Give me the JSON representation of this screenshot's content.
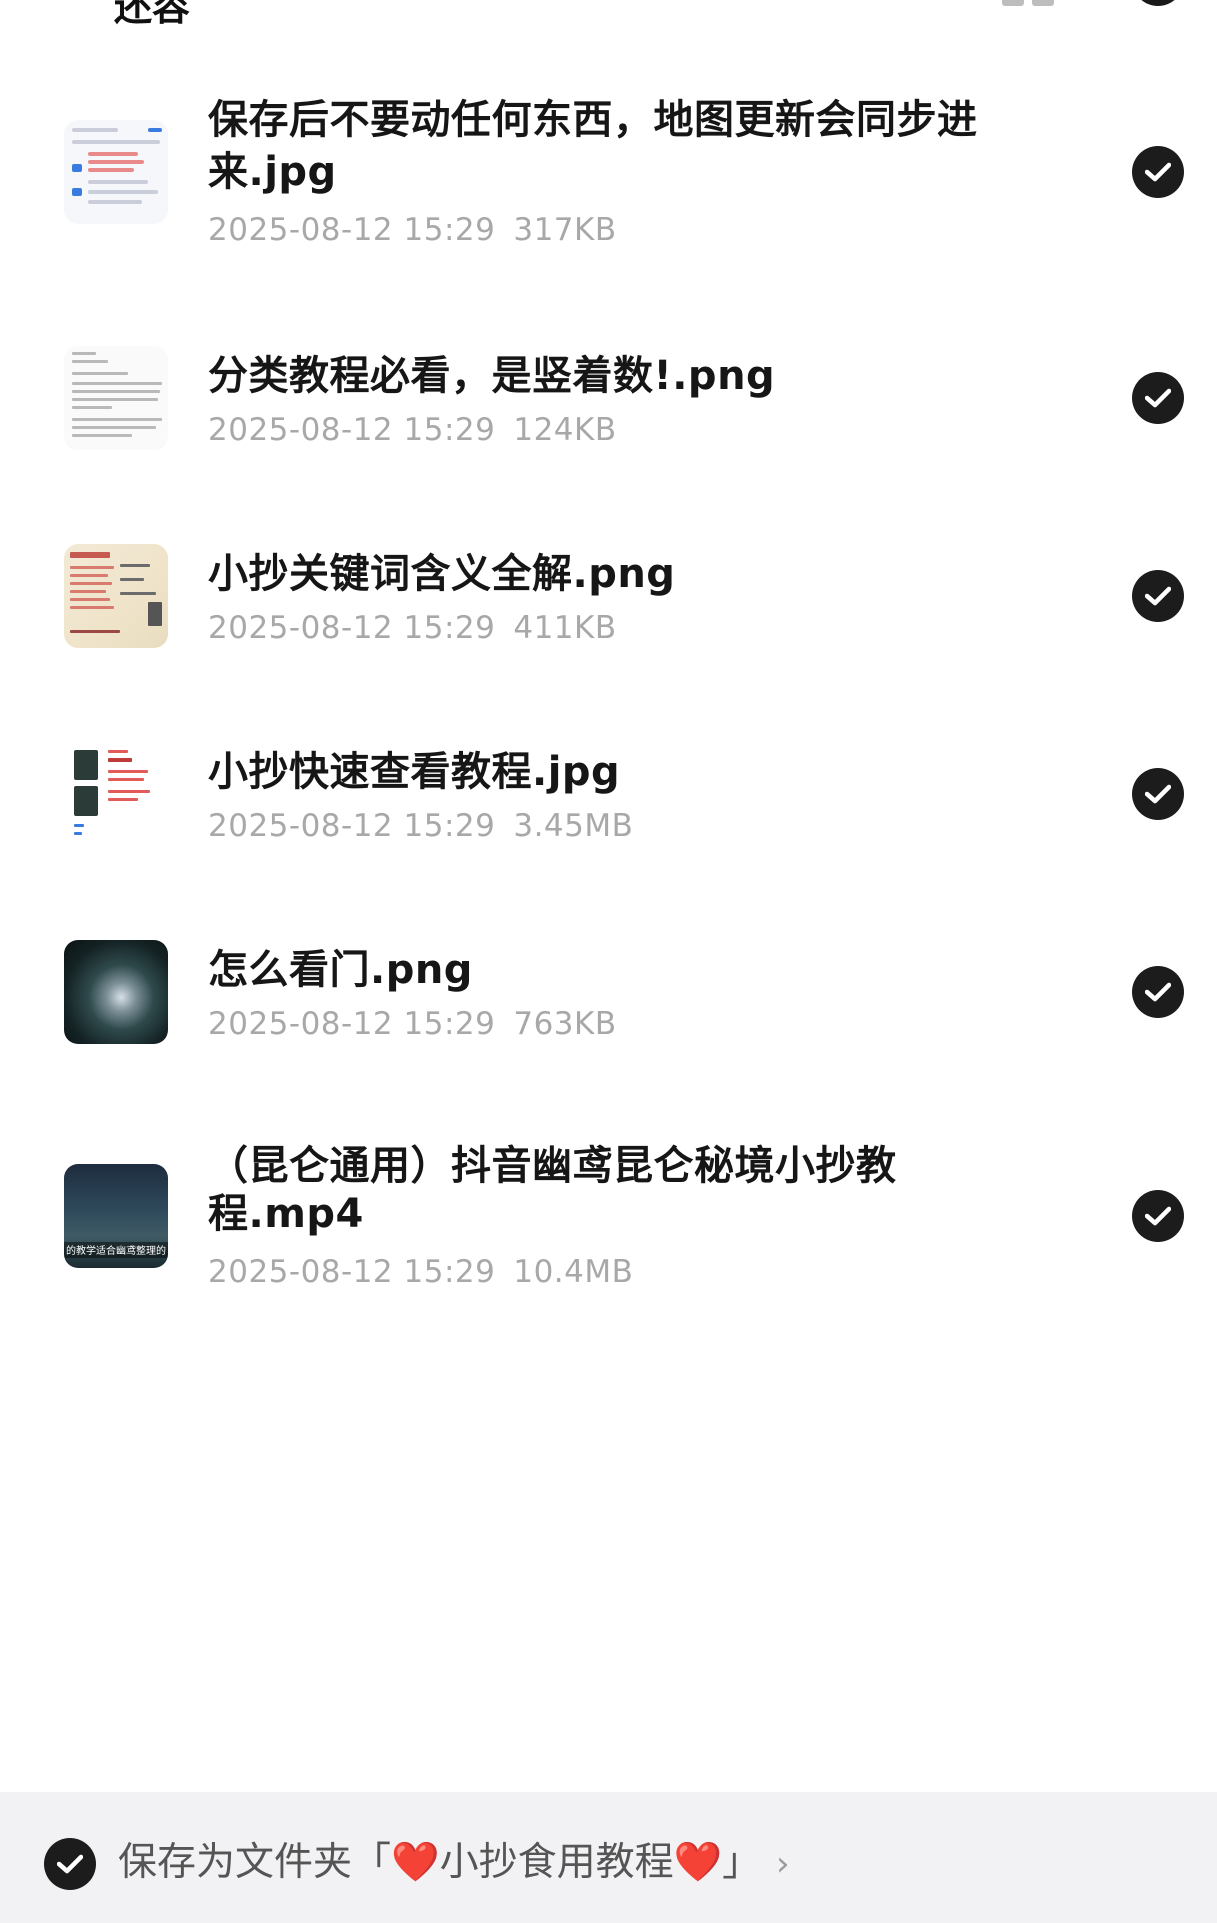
{
  "header": {
    "title": "还容"
  },
  "files": [
    {
      "name": "保存后不要动任何东西，地图更新会同步进来.jpg",
      "date": "2025-08-12 15:29",
      "size": "317KB",
      "selected": true
    },
    {
      "name": "分类教程必看，是竖着数!.png",
      "date": "2025-08-12 15:29",
      "size": "124KB",
      "selected": true
    },
    {
      "name": "小抄关键词含义全解.png",
      "date": "2025-08-12 15:29",
      "size": "411KB",
      "selected": true
    },
    {
      "name": "小抄快速查看教程.jpg",
      "date": "2025-08-12 15:29",
      "size": "3.45MB",
      "selected": true
    },
    {
      "name": "怎么看门.png",
      "date": "2025-08-12 15:29",
      "size": "763KB",
      "selected": true
    },
    {
      "name": "（昆仑通用）抖音幽鸢昆仑秘境小抄教程.mp4",
      "date": "2025-08-12 15:29",
      "size": "10.4MB",
      "selected": true,
      "thumb_caption": "的教学适合幽鸢整理的"
    }
  ],
  "footer": {
    "save_prefix": "保存为文件夹「",
    "heart": "❤️",
    "folder_name": "小抄食用教程",
    "save_suffix": "」",
    "chevron": "›",
    "selected": true
  },
  "colors": {
    "check_bg": "#1c1c1c",
    "meta_text": "#a8a8a8",
    "heart": "#e02e35",
    "footer_bg": "#f2f2f4"
  }
}
